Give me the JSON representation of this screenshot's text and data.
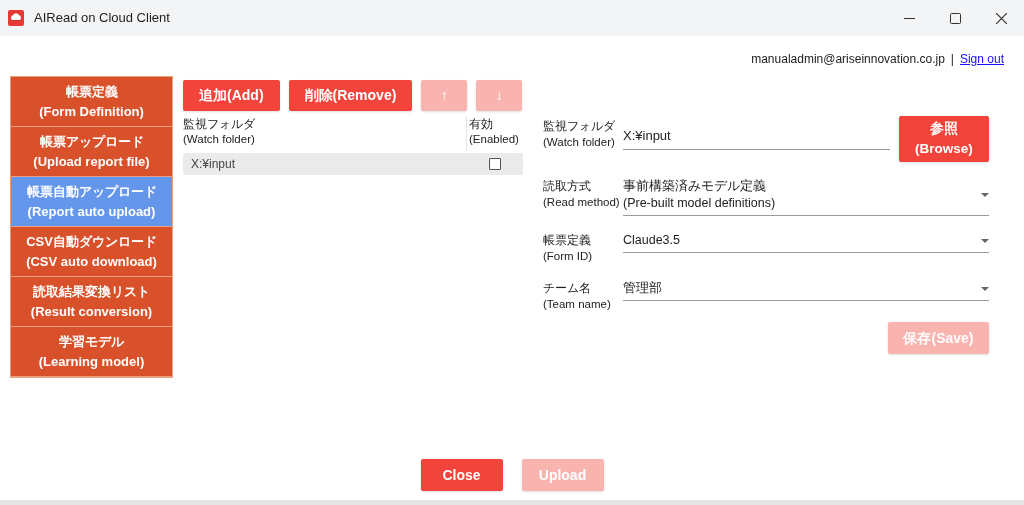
{
  "window": {
    "title": "AIRead on Cloud Client"
  },
  "account": {
    "email": "manualadmin@ariseinnovation.co.jp",
    "separator": "|",
    "sign_out": "Sign out"
  },
  "sidebar": {
    "items": [
      {
        "label_ja": "帳票定義",
        "label_en": "(Form Definition)",
        "selected": false
      },
      {
        "label_ja": "帳票アップロード",
        "label_en": "(Upload report file)",
        "selected": false
      },
      {
        "label_ja": "帳票自動アップロード",
        "label_en": "(Report auto upload)",
        "selected": true
      },
      {
        "label_ja": "CSV自動ダウンロード",
        "label_en": "(CSV auto download)",
        "selected": false
      },
      {
        "label_ja": "読取結果変換リスト",
        "label_en": "(Result conversion)",
        "selected": false
      },
      {
        "label_ja": "学習モデル",
        "label_en": "(Learning model)",
        "selected": false
      }
    ]
  },
  "toolbar": [
    {
      "label": "追加(Add)",
      "disabled": false
    },
    {
      "label": "削除(Remove)",
      "disabled": false
    },
    {
      "label": "↑",
      "disabled": true
    },
    {
      "label": "↓",
      "disabled": true
    }
  ],
  "table": {
    "columns": [
      {
        "label_ja": "監視フォルダ",
        "label_en": "(Watch folder)"
      },
      {
        "label_ja": "有効",
        "label_en": "(Enabled)"
      }
    ],
    "rows": [
      {
        "watch_folder": "X:¥input",
        "enabled": false
      }
    ]
  },
  "form": {
    "fields": [
      {
        "kind": "text",
        "label_ja": "監視フォルダ",
        "label_en": "(Watch folder)",
        "value": "X:¥input"
      },
      {
        "kind": "select",
        "label_ja": "読取方式",
        "label_en": "(Read method)",
        "value": "事前構築済みモデル定義",
        "value_2": "(Pre-built model definitions)"
      },
      {
        "kind": "select",
        "label_ja": "帳票定義",
        "label_en": "(Form ID)",
        "value": "Claude3.5"
      },
      {
        "kind": "select",
        "label_ja": "チーム名",
        "label_en": "(Team name)",
        "value": "管理部"
      }
    ],
    "browse": {
      "label_ja": "参照",
      "label_en": "(Browse)",
      "disabled": false
    },
    "save": {
      "label": "保存(Save)",
      "disabled": true
    }
  },
  "footer": [
    {
      "label": "Close",
      "disabled": false
    },
    {
      "label": "Upload",
      "disabled": true
    }
  ]
}
